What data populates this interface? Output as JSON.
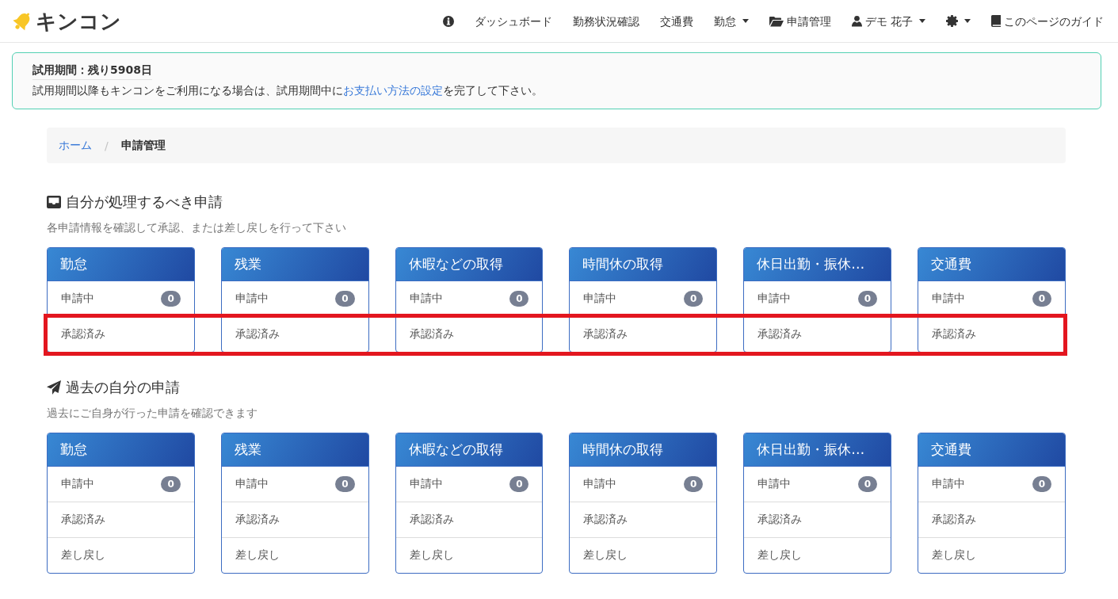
{
  "header": {
    "logo": "キンコン",
    "nav": [
      {
        "kind": "info",
        "dropdown": false
      },
      {
        "kind": "link",
        "label": "ダッシュボード",
        "dropdown": false
      },
      {
        "kind": "link",
        "label": "勤務状況確認",
        "dropdown": false
      },
      {
        "kind": "link",
        "label": "交通費",
        "dropdown": false
      },
      {
        "kind": "link",
        "label": "勤怠",
        "dropdown": true
      },
      {
        "kind": "folder",
        "label": "申請管理",
        "dropdown": false
      },
      {
        "kind": "user",
        "label": "デモ 花子",
        "dropdown": true
      },
      {
        "kind": "settings",
        "dropdown": true
      },
      {
        "kind": "guide",
        "label": "このページのガイド",
        "dropdown": false
      }
    ]
  },
  "trial_banner": {
    "title": "試用期間：残り5908日",
    "message_start": "試用期間以降もキンコンをご利用になる場合は、試用期間中に",
    "link": "お支払い方法の設定",
    "message_end": "を完了して下さい。"
  },
  "breadcrumb": {
    "separator": "/",
    "items": [
      {
        "label": "ホーム",
        "current": false
      },
      {
        "label": "申請管理",
        "current": true
      }
    ]
  },
  "sections": [
    {
      "kind": "inbox",
      "title": "自分が処理するべき申請",
      "subtitle": "各申請情報を確認して承認、または差し戻しを行って下さい",
      "approved_rows_highlighted": true,
      "cards": [
        {
          "title": "勤怠",
          "rows": [
            {
              "kind": "pending",
              "label": "申請中",
              "count": "0"
            },
            {
              "kind": "approved",
              "label": "承認済み"
            }
          ]
        },
        {
          "title": "残業",
          "rows": [
            {
              "kind": "pending",
              "label": "申請中",
              "count": "0"
            },
            {
              "kind": "approved",
              "label": "承認済み"
            }
          ]
        },
        {
          "title": "休暇などの取得",
          "rows": [
            {
              "kind": "pending",
              "label": "申請中",
              "count": "0"
            },
            {
              "kind": "approved",
              "label": "承認済み"
            }
          ]
        },
        {
          "title": "時間休の取得",
          "rows": [
            {
              "kind": "pending",
              "label": "申請中",
              "count": "0"
            },
            {
              "kind": "approved",
              "label": "承認済み"
            }
          ]
        },
        {
          "title": "休日出勤・振休…",
          "rows": [
            {
              "kind": "pending",
              "label": "申請中",
              "count": "0"
            },
            {
              "kind": "approved",
              "label": "承認済み"
            }
          ]
        },
        {
          "title": "交通費",
          "rows": [
            {
              "kind": "pending",
              "label": "申請中",
              "count": "0"
            },
            {
              "kind": "approved",
              "label": "承認済み"
            }
          ]
        }
      ]
    },
    {
      "kind": "sent",
      "title": "過去の自分の申請",
      "subtitle": "過去にご自身が行った申請を確認できます",
      "approved_rows_highlighted": false,
      "cards": [
        {
          "title": "勤怠",
          "rows": [
            {
              "kind": "pending",
              "label": "申請中",
              "count": "0"
            },
            {
              "kind": "approved",
              "label": "承認済み"
            },
            {
              "kind": "returned",
              "label": "差し戻し"
            }
          ]
        },
        {
          "title": "残業",
          "rows": [
            {
              "kind": "pending",
              "label": "申請中",
              "count": "0"
            },
            {
              "kind": "approved",
              "label": "承認済み"
            },
            {
              "kind": "returned",
              "label": "差し戻し"
            }
          ]
        },
        {
          "title": "休暇などの取得",
          "rows": [
            {
              "kind": "pending",
              "label": "申請中",
              "count": "0"
            },
            {
              "kind": "approved",
              "label": "承認済み"
            },
            {
              "kind": "returned",
              "label": "差し戻し"
            }
          ]
        },
        {
          "title": "時間休の取得",
          "rows": [
            {
              "kind": "pending",
              "label": "申請中",
              "count": "0"
            },
            {
              "kind": "approved",
              "label": "承認済み"
            },
            {
              "kind": "returned",
              "label": "差し戻し"
            }
          ]
        },
        {
          "title": "休日出勤・振休…",
          "rows": [
            {
              "kind": "pending",
              "label": "申請中",
              "count": "0"
            },
            {
              "kind": "approved",
              "label": "承認済み"
            },
            {
              "kind": "returned",
              "label": "差し戻し"
            }
          ]
        },
        {
          "title": "交通費",
          "rows": [
            {
              "kind": "pending",
              "label": "申請中",
              "count": "0"
            },
            {
              "kind": "approved",
              "label": "承認済み"
            },
            {
              "kind": "returned",
              "label": "差し戻し"
            }
          ]
        }
      ]
    }
  ]
}
